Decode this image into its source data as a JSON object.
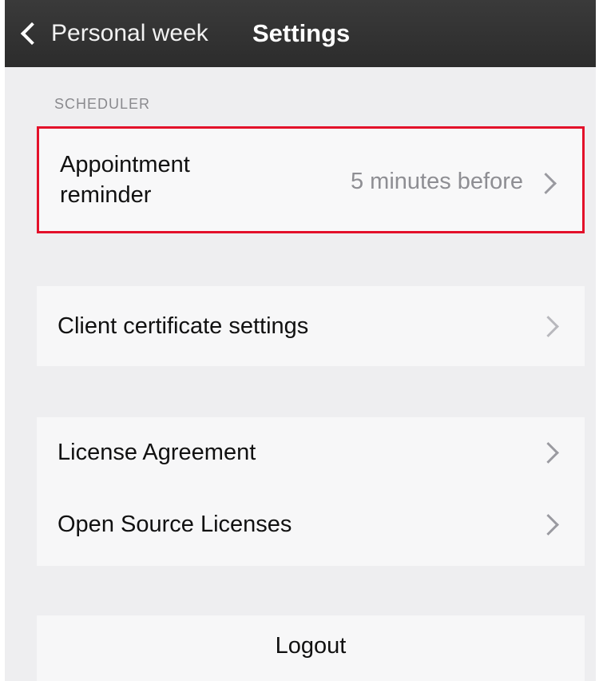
{
  "nav": {
    "back_label": "Personal week",
    "title": "Settings"
  },
  "scheduler": {
    "section_header": "SCHEDULER",
    "appointment_reminder": {
      "label": "Appointment reminder",
      "value": "5 minutes before"
    }
  },
  "certificates": {
    "label": "Client certificate settings"
  },
  "legal": {
    "license_agreement": "License Agreement",
    "open_source_licenses": "Open Source Licenses"
  },
  "account": {
    "logout_label": "Logout"
  },
  "colors": {
    "nav_background": "#2c2c2c",
    "highlight_border": "#e3102a",
    "secondary_text": "#8e8e93"
  },
  "icons": {
    "back": "chevron-left-icon",
    "disclosure": "chevron-right-icon"
  }
}
